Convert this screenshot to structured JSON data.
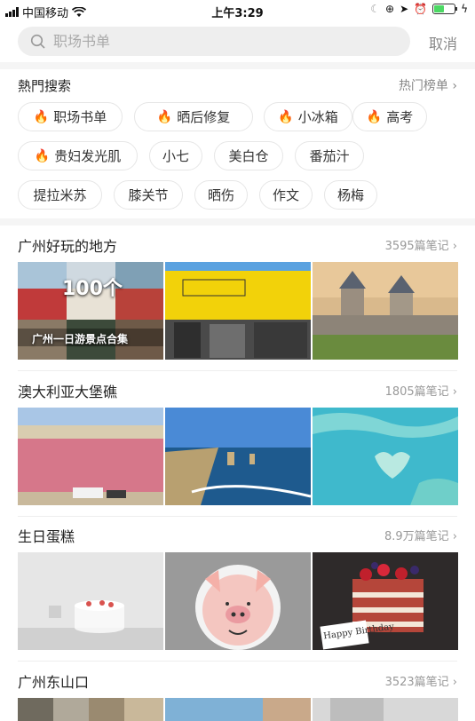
{
  "status_bar": {
    "carrier": "中国移动",
    "time": "上午3:29"
  },
  "search": {
    "placeholder": "职场书单",
    "cancel_label": "取消"
  },
  "hot_search": {
    "title": "熱門搜索",
    "rank_link": "热门榜单",
    "chips": [
      {
        "label": "职场书单",
        "hot": true
      },
      {
        "label": "晒后修复",
        "hot": true
      },
      {
        "label": "小冰箱",
        "hot": true
      },
      {
        "label": "高考",
        "hot": true
      },
      {
        "label": "贵妇发光肌",
        "hot": true
      },
      {
        "label": "小七",
        "hot": false
      },
      {
        "label": "美白仓",
        "hot": false
      },
      {
        "label": "番茄汁",
        "hot": false
      },
      {
        "label": "提拉米苏",
        "hot": false
      },
      {
        "label": "膝关节",
        "hot": false
      },
      {
        "label": "晒伤",
        "hot": false
      },
      {
        "label": "作文",
        "hot": false
      },
      {
        "label": "杨梅",
        "hot": false
      }
    ]
  },
  "sections": [
    {
      "title": "广州好玩的地方",
      "count": "3595篇笔记",
      "overlay_big": "100个",
      "overlay_small": "广州一日游景点合集"
    },
    {
      "title": "澳大利亚大堡礁",
      "count": "1805篇笔记"
    },
    {
      "title": "生日蛋糕",
      "count": "8.9万篇笔记",
      "cake_label": "Happy Birthday"
    },
    {
      "title": "广州东山口",
      "count": "3523篇笔记"
    }
  ],
  "colors": {
    "accent": "#ff2442",
    "chip_border": "#e6e6e6",
    "muted_text": "#999999"
  }
}
